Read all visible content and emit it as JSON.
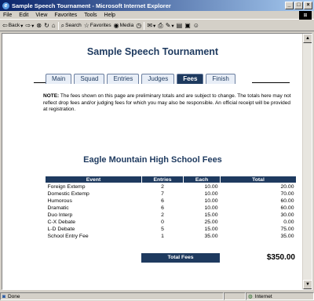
{
  "window": {
    "title": "Sample Speech Tournament - Microsoft Internet Explorer"
  },
  "menu": [
    "File",
    "Edit",
    "View",
    "Favorites",
    "Tools",
    "Help"
  ],
  "toolbar": {
    "back": "Back",
    "search": "Search",
    "favorites": "Favorites",
    "media": "Media"
  },
  "page": {
    "title": "Sample Speech Tournament",
    "tabs": [
      "Main",
      "Squad",
      "Entries",
      "Judges",
      "Fees",
      "Finish"
    ],
    "active_tab": "Fees",
    "note_label": "NOTE:",
    "note_text": " The fees shown on this page are preliminary totals and are subject to change. The totals here may not reflect drop fees and/or judging fees for which you may also be responsible. An official receipt will be provided at registration.",
    "school_title": "Eagle Mountain High School Fees",
    "table": {
      "headers": [
        "Event",
        "Entries",
        "Each",
        "Total"
      ],
      "rows": [
        [
          "Foreign Extemp",
          "2",
          "10.00",
          "20.00"
        ],
        [
          "Domestic Extemp",
          "7",
          "10.00",
          "70.00"
        ],
        [
          "Humorous",
          "6",
          "10.00",
          "60.00"
        ],
        [
          "Dramatic",
          "6",
          "10.00",
          "60.00"
        ],
        [
          "Duo Interp",
          "2",
          "15.00",
          "30.00"
        ],
        [
          "C-X Debate",
          "0",
          "25.00",
          "0.00"
        ],
        [
          "L-D Debate",
          "5",
          "15.00",
          "75.00"
        ],
        [
          "School Entry Fee",
          "1",
          "35.00",
          "35.00"
        ]
      ]
    },
    "total_label": "Total Fees",
    "total_value": "$350.00"
  },
  "status": {
    "left": "Done",
    "zone": "Internet"
  }
}
